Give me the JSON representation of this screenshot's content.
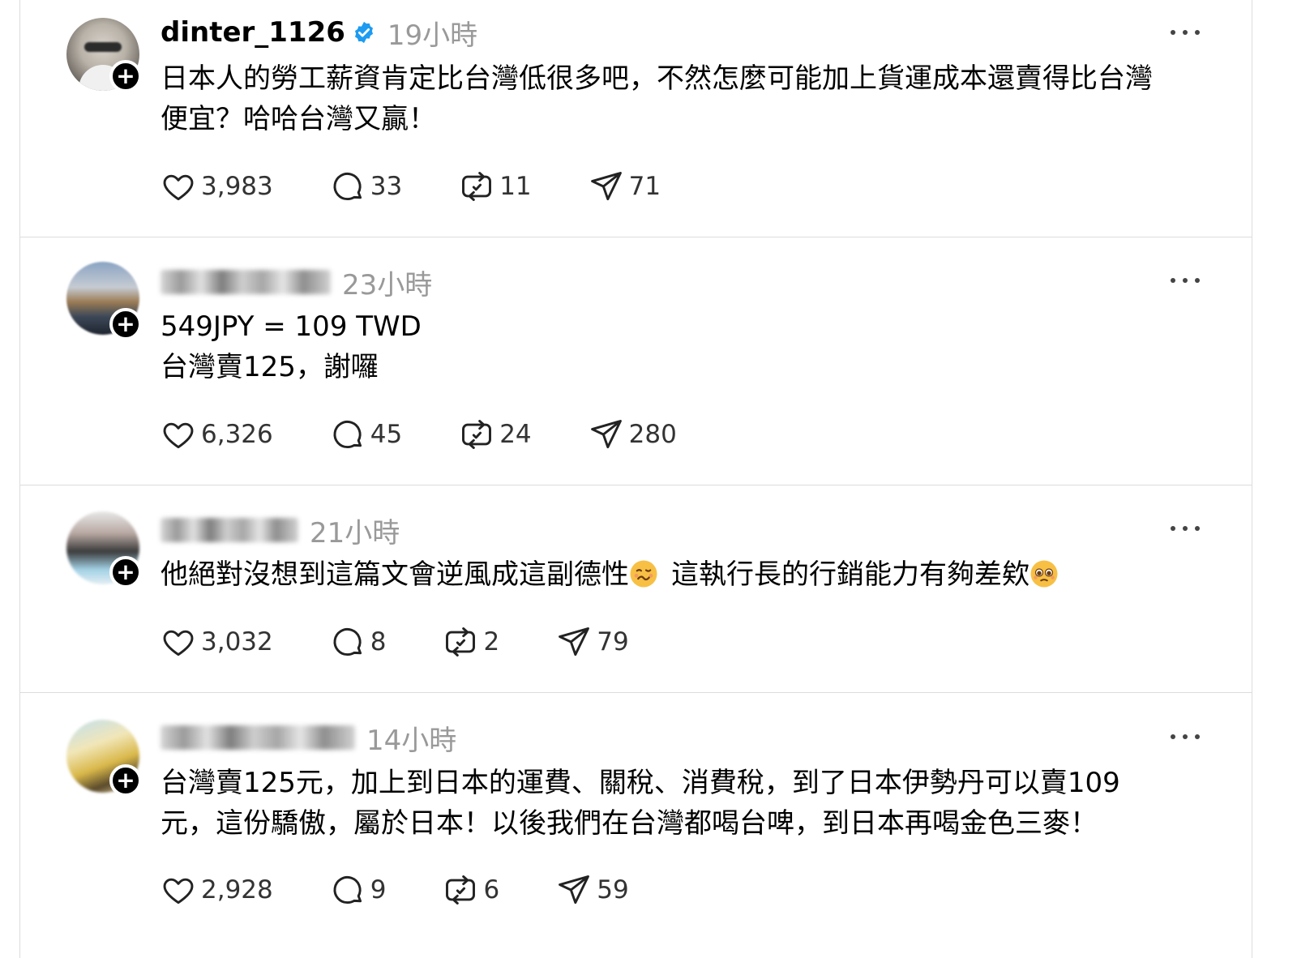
{
  "posts": [
    {
      "username": "dinter_1126",
      "verified": true,
      "timestamp": "19小時",
      "text": "日本人的勞工薪資肯定比台灣低很多吧，不然怎麼可能加上貨運成本還賣得比台灣\n便宜？哈哈台灣又贏！",
      "likes": "3,983",
      "replies": "33",
      "reposts": "11",
      "shares": "71"
    },
    {
      "username": "",
      "verified": false,
      "timestamp": "23小時",
      "text": "549JPY = 109 TWD\n台灣賣125，謝囉",
      "likes": "6,326",
      "replies": "45",
      "reposts": "24",
      "shares": "280"
    },
    {
      "username": "",
      "verified": false,
      "timestamp": "21小時",
      "text_part1": "他絕對沒想到這篇文會逆風成這副德性",
      "text_part2": "這執行長的行銷能力有夠差欸",
      "emoji_1": "woozy-face",
      "emoji_2": "pleading-face",
      "likes": "3,032",
      "replies": "8",
      "reposts": "2",
      "shares": "79"
    },
    {
      "username": "",
      "verified": false,
      "timestamp": "14小時",
      "text": "台灣賣125元，加上到日本的運費、關稅、消費稅，到了日本伊勢丹可以賣109\n元，這份驕傲，屬於日本！以後我們在台灣都喝台啤，到日本再喝金色三麥！",
      "likes": "2,928",
      "replies": "9",
      "reposts": "6",
      "shares": "59"
    }
  ],
  "icons": {
    "like": "heart-icon",
    "reply": "comment-icon",
    "repost": "repost-icon",
    "share": "send-icon",
    "more": "more-icon",
    "follow": "plus-icon",
    "verified": "verified-badge-icon"
  },
  "colors": {
    "verified": "#1d9bf0",
    "timestamp": "#999999",
    "divider": "#dcdcdc"
  }
}
